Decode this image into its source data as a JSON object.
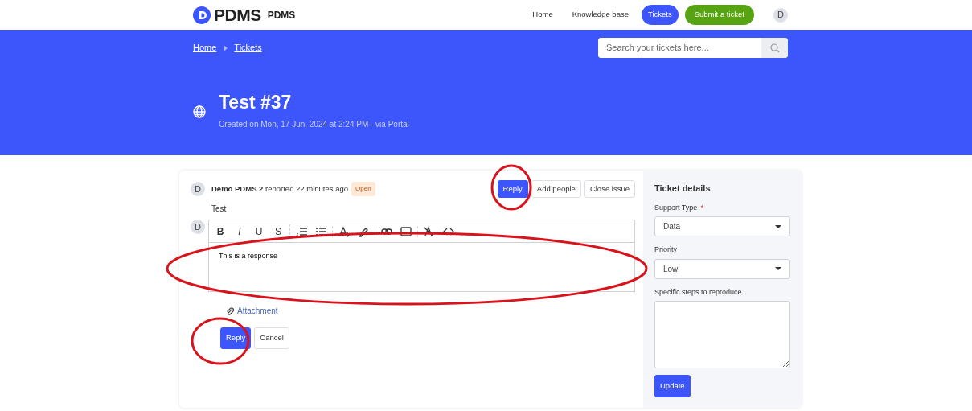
{
  "navbar": {
    "brand": "PDMS",
    "brand_sub": "PDMS",
    "links": [
      {
        "label": "Home",
        "kind": "link",
        "selected": false
      },
      {
        "label": "Knowledge base",
        "kind": "link",
        "selected": false
      },
      {
        "label": "Tickets",
        "kind": "link",
        "selected": true
      },
      {
        "label": "Submit a ticket",
        "kind": "cta",
        "selected": false
      }
    ],
    "avatar": "D"
  },
  "banner": {
    "breadcrumb": [
      "Home",
      "Tickets"
    ],
    "search": {
      "placeholder": "Search your tickets here..."
    },
    "title": "Test #37",
    "subtitle": "Created on Mon, 17 Jun, 2024 at 2:24 PM - via Portal"
  },
  "ticket": {
    "avatar": "D",
    "byline": "**Demo PDMS 2** reported 22 minutes ago",
    "status": "Open",
    "actions": [
      {
        "label": "Reply",
        "kind": "primary"
      },
      {
        "label": "Add people",
        "kind": "outline"
      },
      {
        "label": "Close issue",
        "kind": "outline"
      }
    ],
    "body": "Test"
  },
  "editor": {
    "avatar": "D",
    "toolbar": [
      [
        {
          "kind": "bold",
          "label": "B"
        },
        {
          "kind": "italic",
          "label": "I"
        },
        {
          "kind": "underline",
          "label": "U"
        },
        {
          "kind": "strike",
          "label": "S"
        }
      ],
      [
        {
          "kind": "ordered-list"
        },
        {
          "kind": "bullet-list"
        }
      ],
      [
        {
          "kind": "text-color"
        },
        {
          "kind": "highlight"
        }
      ],
      [
        {
          "kind": "link"
        },
        {
          "kind": "image"
        }
      ],
      [
        {
          "kind": "clear-format"
        },
        {
          "kind": "code"
        }
      ]
    ],
    "value": "This is a response",
    "attachment": "Attachment",
    "buttons": [
      {
        "label": "Reply",
        "kind": "primary"
      },
      {
        "label": "Cancel",
        "kind": "outline"
      }
    ]
  },
  "details": {
    "title": "Ticket details",
    "fields": [
      {
        "label": "Support Type",
        "required_mark": "*",
        "kind": "select",
        "value": "Data"
      },
      {
        "label": "Priority",
        "kind": "select",
        "value": "Low"
      },
      {
        "label": "Specific steps to reproduce",
        "kind": "textarea"
      }
    ],
    "button": "Update"
  },
  "annotations": [
    {
      "color": "#d9131b"
    },
    {
      "color": "#d9131b"
    },
    {
      "color": "#d9131b"
    }
  ]
}
